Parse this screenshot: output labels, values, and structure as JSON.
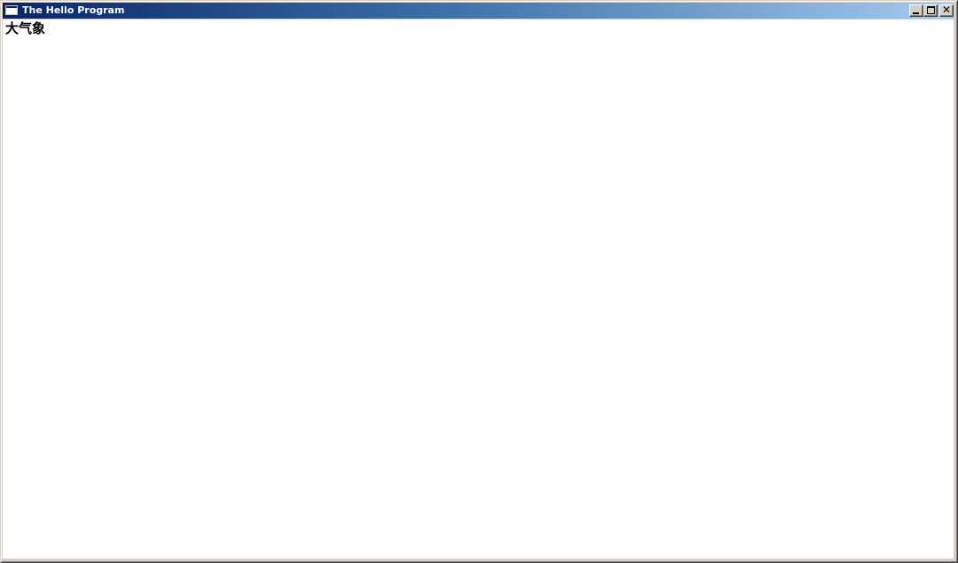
{
  "window": {
    "title": "The Hello Program",
    "icon": "window-app-icon"
  },
  "caption_buttons": {
    "minimize": "minimize-icon",
    "maximize": "maximize-icon",
    "close": "close-icon",
    "close_glyph": "✕"
  },
  "client": {
    "text": "大气象"
  },
  "colors": {
    "titlebar_start": "#0a246a",
    "titlebar_end": "#a6caf0",
    "client_background": "#ffffff"
  }
}
